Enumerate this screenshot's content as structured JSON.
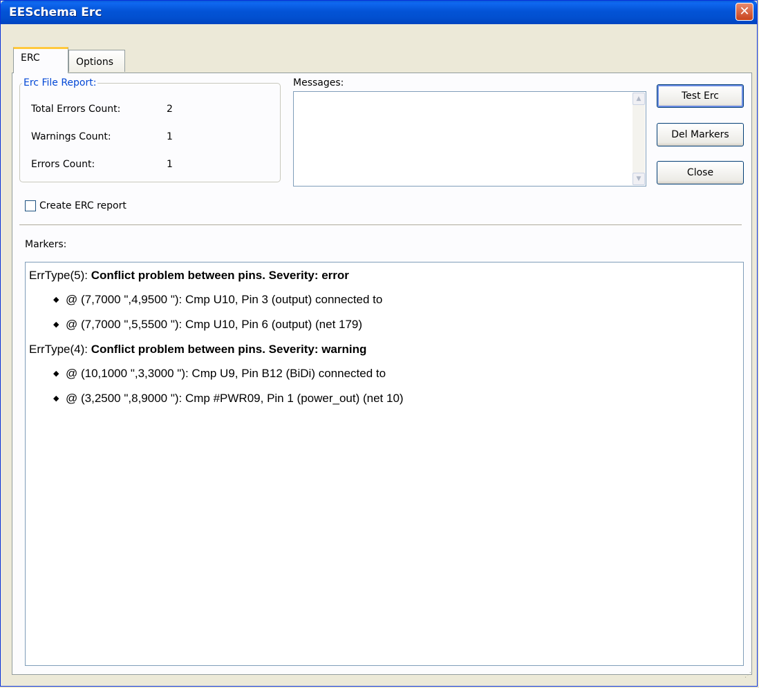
{
  "window": {
    "title": "EESchema Erc",
    "close_glyph": "✕"
  },
  "tabs": [
    {
      "label": "ERC",
      "active": true
    },
    {
      "label": "Options",
      "active": false
    }
  ],
  "report": {
    "legend": "Erc File Report:",
    "rows": [
      {
        "label": "Total Errors Count:",
        "value": "2"
      },
      {
        "label": "Warnings Count:",
        "value": "1"
      },
      {
        "label": "Errors Count:",
        "value": "1"
      }
    ]
  },
  "messages": {
    "label": "Messages:",
    "value": ""
  },
  "buttons": {
    "test_erc": "Test Erc",
    "del_markers": "Del Markers",
    "close": "Close"
  },
  "create_report": {
    "label": "Create ERC report",
    "checked": false
  },
  "markers": {
    "label": "Markers:",
    "groups": [
      {
        "type": "ErrType(5): ",
        "text": "Conflict problem between pins. Severity: error",
        "items": [
          "@ (7,7000 \",4,9500 \"): Cmp U10, Pin 3 (output) connected to",
          "@ (7,7000 \",5,5500 \"): Cmp U10, Pin 6 (output) (net 179)"
        ]
      },
      {
        "type": "ErrType(4): ",
        "text": "Conflict problem between pins. Severity: warning",
        "items": [
          "@ (10,1000 \",3,3000 \"): Cmp U9, Pin B12 (BiDi) connected to",
          "@ (3,2500 \",8,9000 \"): Cmp #PWR09, Pin 1 (power_out) (net 10)"
        ]
      }
    ]
  },
  "icons": {
    "bullet": "◆",
    "scroll_up": "▲",
    "scroll_down": "▼"
  },
  "colors": {
    "titlebar": "#0353d6",
    "legend": "#0046d5",
    "active_tab_accent": "#ffc83c"
  }
}
